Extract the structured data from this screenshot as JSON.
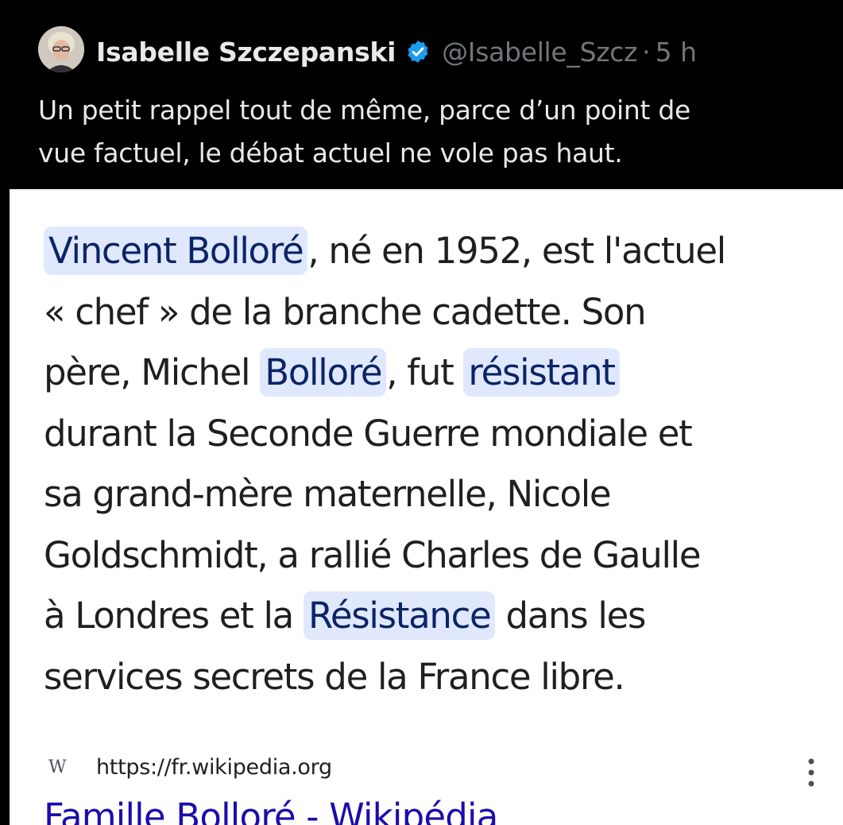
{
  "tweet": {
    "author_name": "Isabelle Szczepanski",
    "handle": "@Isabelle_Szcz",
    "separator": "·",
    "time": "5 h",
    "text_line_1": "Un petit rappel tout de même, parce d’un point de",
    "text_line_2": "vue factuel, le débat actuel ne vole pas haut.",
    "icons": [
      "avatar",
      "verified-badge-icon"
    ],
    "colors": {
      "background": "#000000",
      "name": "#e7e9ea",
      "muted": "#71767b",
      "verified": "#1d9bf0"
    }
  },
  "card": {
    "snippet": {
      "l1_hl": "Vincent Bolloré",
      "l1_rest": ", né en 1952, est l'actuel",
      "l2": "« chef » de la branche cadette. Son",
      "l3_a": "père, Michel ",
      "l3_hl1": "Bolloré",
      "l3_b": ", fut ",
      "l3_hl2": "résistant",
      "l4": "durant la Seconde Guerre mondiale et",
      "l5": "sa grand-mère maternelle, Nicole",
      "l6": "Goldschmidt, a rallié Charles de Gaulle",
      "l7_a": "à Londres et la ",
      "l7_hl": "Résistance",
      "l7_b": " dans les",
      "l8": "services secrets de la France libre."
    },
    "source": {
      "icon_glyph": "W",
      "url": "https://fr.wikipedia.org"
    },
    "result_title": "Famille Bolloré - Wikipédia",
    "icons": [
      "wikipedia-icon",
      "more-vertical-icon"
    ],
    "colors": {
      "highlight_bg": "#dfe8fd",
      "highlight_text": "#0b2466",
      "link": "#1a0dab"
    }
  }
}
